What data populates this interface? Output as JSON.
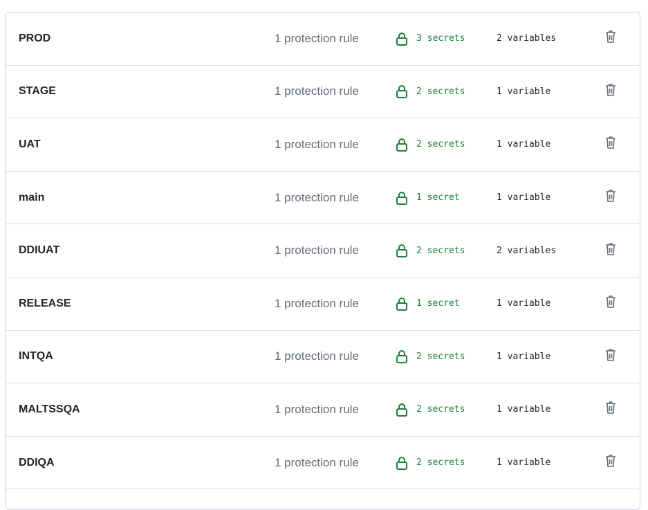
{
  "environments": [
    {
      "name": "PROD",
      "rules": "1 protection rule",
      "secrets": "3 secrets",
      "variables": "2 variables"
    },
    {
      "name": "STAGE",
      "rules": "1 protection rule",
      "secrets": "2 secrets",
      "variables": "1 variable"
    },
    {
      "name": "UAT",
      "rules": "1 protection rule",
      "secrets": "2 secrets",
      "variables": "1 variable"
    },
    {
      "name": "main",
      "rules": "1 protection rule",
      "secrets": "1 secret",
      "variables": "1 variable"
    },
    {
      "name": "DDIUAT",
      "rules": "1 protection rule",
      "secrets": "2 secrets",
      "variables": "2 variables"
    },
    {
      "name": "RELEASE",
      "rules": "1 protection rule",
      "secrets": "1 secret",
      "variables": "1 variable"
    },
    {
      "name": "INTQA",
      "rules": "1 protection rule",
      "secrets": "2 secrets",
      "variables": "1 variable"
    },
    {
      "name": "MALTSSQA",
      "rules": "1 protection rule",
      "secrets": "2 secrets",
      "variables": "1 variable"
    },
    {
      "name": "DDIQA",
      "rules": "1 protection rule",
      "secrets": "2 secrets",
      "variables": "1 variable"
    }
  ],
  "icons": {
    "secret": "lock-icon",
    "delete": "trash-icon"
  },
  "colors": {
    "secret_green": "#1a7f37",
    "muted_text": "#656d76",
    "border": "#d0d7de"
  }
}
